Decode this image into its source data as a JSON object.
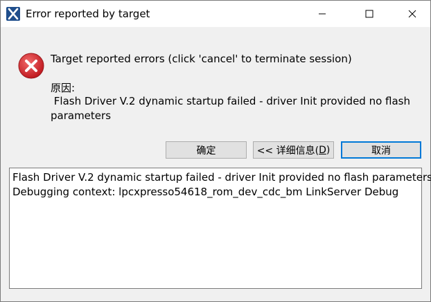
{
  "window": {
    "title": "Error reported by target",
    "icon": "x-app-icon",
    "controls": {
      "minimize_icon": "minimize-icon",
      "maximize_icon": "maximize-icon",
      "close_icon": "close-icon"
    }
  },
  "dialog": {
    "icon": "error-icon",
    "message": "Target reported errors (click 'cancel' to terminate session)",
    "reason_label": "原因:",
    "reason_text": " Flash Driver V.2 dynamic startup failed - driver Init provided no flash parameters",
    "buttons": {
      "ok_label": "确定",
      "details_prefix": "<< 详细信息(",
      "details_mnemonic": "D",
      "details_suffix": ")",
      "cancel_label": "取消"
    },
    "details": [
      "Flash Driver V.2 dynamic startup failed - driver Init provided no flash parameters",
      "Debugging context: lpcxpresso54618_rom_dev_cdc_bm LinkServer Debug"
    ]
  },
  "colors": {
    "accent": "#0078d7",
    "error_red": "#d9262c",
    "app_icon_blue": "#1f4e8c"
  }
}
